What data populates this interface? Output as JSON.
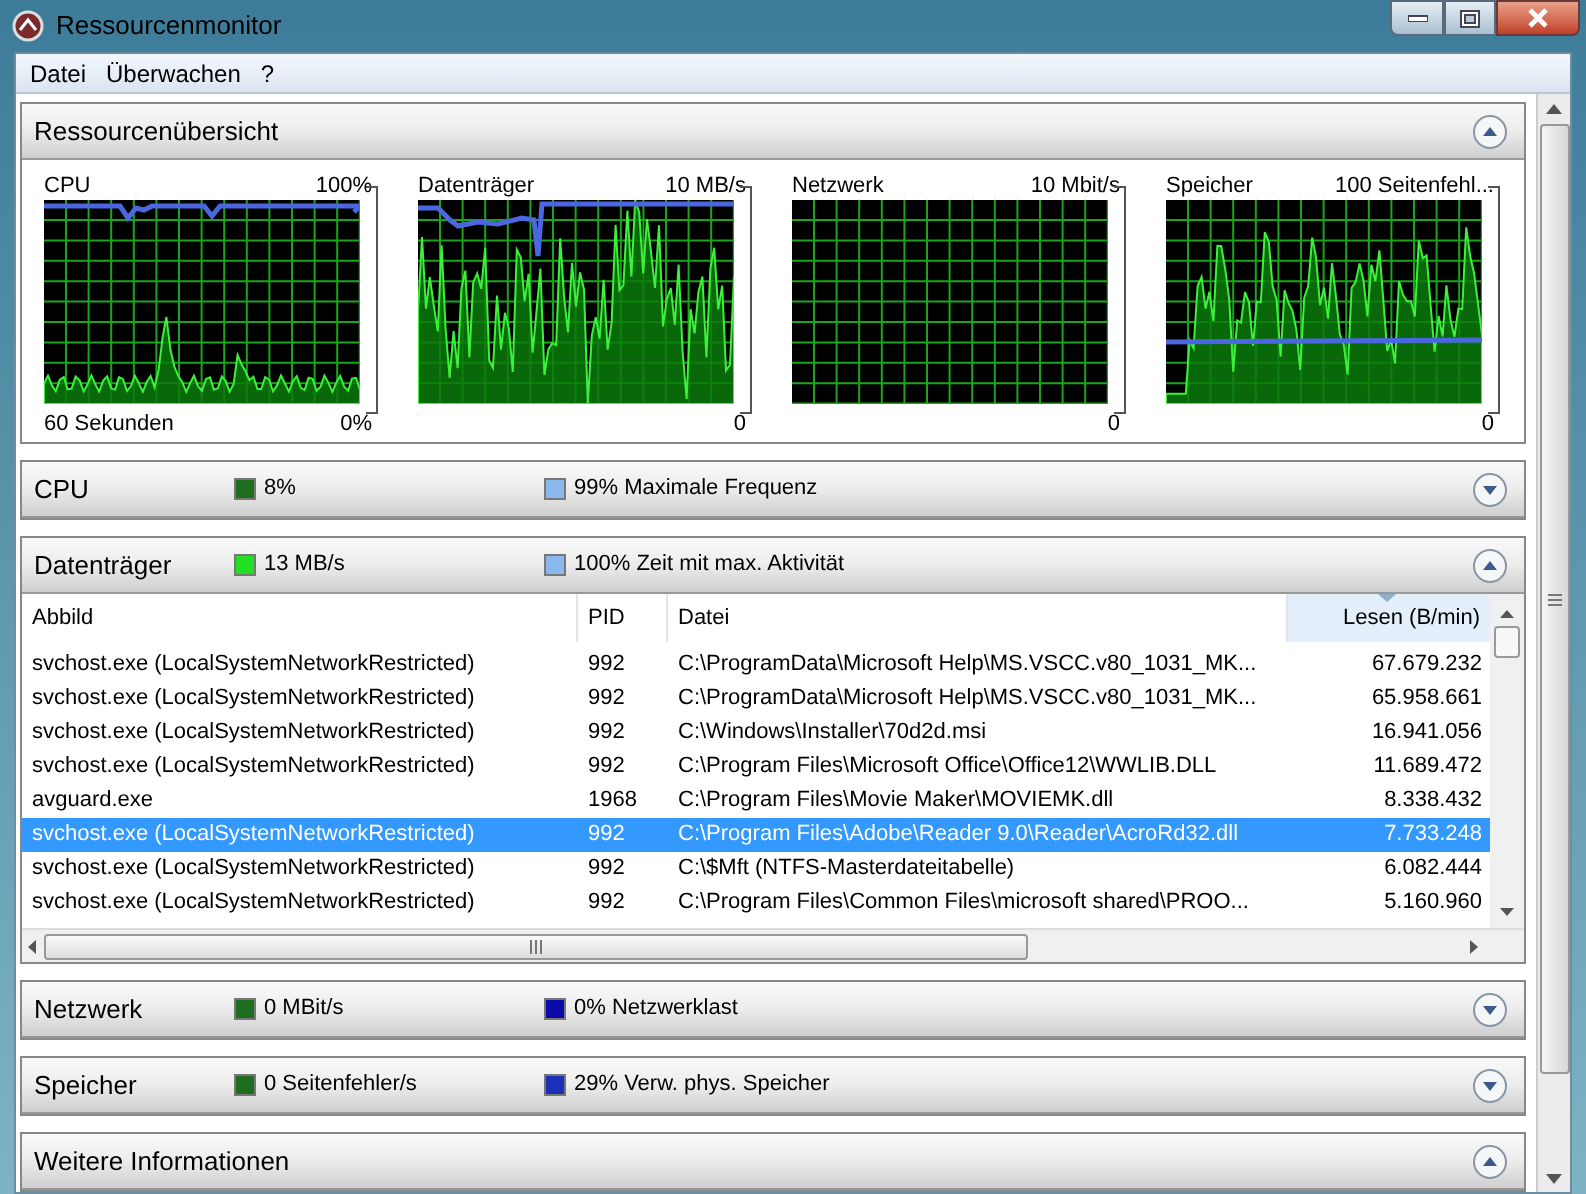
{
  "window": {
    "title": "Ressourcenmonitor"
  },
  "menu": [
    "Datei",
    "Überwachen",
    "?"
  ],
  "overview": {
    "title": "Ressourcenübersicht",
    "expanded": true,
    "graphs": [
      {
        "label": "CPU",
        "top_scale": "100%",
        "bottom_left": "60 Sekunden",
        "bottom_scale": "0%"
      },
      {
        "label": "Datenträger",
        "top_scale": "10 MB/s",
        "bottom_scale": "0"
      },
      {
        "label": "Netzwerk",
        "top_scale": "10 Mbit/s",
        "bottom_scale": "0"
      },
      {
        "label": "Speicher",
        "top_scale": "100 Seitenfehl...",
        "bottom_scale": "0"
      }
    ]
  },
  "sections": [
    {
      "title": "CPU",
      "expanded": false,
      "legend": [
        {
          "color": "#1f6e1f",
          "text": "8%"
        },
        {
          "color": "#8ab8ec",
          "text": "99% Maximale Frequenz"
        }
      ]
    },
    {
      "title": "Datenträger",
      "expanded": true,
      "legend": [
        {
          "color": "#22e022",
          "text": "13 MB/s"
        },
        {
          "color": "#8ab8ec",
          "text": "100% Zeit mit max. Aktivität"
        }
      ],
      "table": {
        "columns": [
          {
            "label": "Abbild",
            "sorted": false
          },
          {
            "label": "PID",
            "sorted": false
          },
          {
            "label": "Datei",
            "sorted": false
          },
          {
            "label": "Lesen (B/min)",
            "sorted": true
          }
        ],
        "rows": [
          {
            "selected": false,
            "cells": [
              "svchost.exe (LocalSystemNetworkRestricted)",
              "992",
              "C:\\ProgramData\\Microsoft Help\\MS.VSCC.v80_1031_MK...",
              "67.679.232"
            ]
          },
          {
            "selected": false,
            "cells": [
              "svchost.exe (LocalSystemNetworkRestricted)",
              "992",
              "C:\\ProgramData\\Microsoft Help\\MS.VSCC.v80_1031_MK...",
              "65.958.661"
            ]
          },
          {
            "selected": false,
            "cells": [
              "svchost.exe (LocalSystemNetworkRestricted)",
              "992",
              "C:\\Windows\\Installer\\70d2d.msi",
              "16.941.056"
            ]
          },
          {
            "selected": false,
            "cells": [
              "svchost.exe (LocalSystemNetworkRestricted)",
              "992",
              "C:\\Program Files\\Microsoft Office\\Office12\\WWLIB.DLL",
              "11.689.472"
            ]
          },
          {
            "selected": false,
            "cells": [
              "avguard.exe",
              "1968",
              "C:\\Program Files\\Movie Maker\\MOVIEMK.dll",
              "8.338.432"
            ]
          },
          {
            "selected": true,
            "cells": [
              "svchost.exe (LocalSystemNetworkRestricted)",
              "992",
              "C:\\Program Files\\Adobe\\Reader 9.0\\Reader\\AcroRd32.dll",
              "7.733.248"
            ]
          },
          {
            "selected": false,
            "cells": [
              "svchost.exe (LocalSystemNetworkRestricted)",
              "992",
              "C:\\$Mft (NTFS-Masterdateitabelle)",
              "6.082.444"
            ]
          },
          {
            "selected": false,
            "cells": [
              "svchost.exe (LocalSystemNetworkRestricted)",
              "992",
              "C:\\Program Files\\Common Files\\microsoft shared\\PROO...",
              "5.160.960"
            ]
          }
        ]
      }
    },
    {
      "title": "Netzwerk",
      "expanded": false,
      "legend": [
        {
          "color": "#1f6e1f",
          "text": "0 MBit/s"
        },
        {
          "color": "#0a0aa8",
          "text": "0% Netzwerklast"
        }
      ]
    },
    {
      "title": "Speicher",
      "expanded": false,
      "legend": [
        {
          "color": "#1f6e1f",
          "text": "0 Seitenfehler/s"
        },
        {
          "color": "#1c2fb8",
          "text": "29% Verw. phys. Speicher"
        }
      ]
    },
    {
      "title": "Weitere Informationen",
      "expanded": true
    }
  ]
}
